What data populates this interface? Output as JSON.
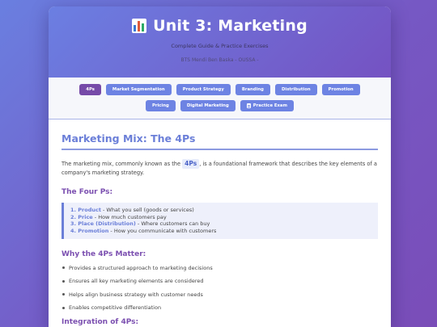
{
  "header": {
    "icon": "bar-chart-icon",
    "title": "Unit 3: Marketing",
    "subtitle": "Complete Guide & Practice Exercises",
    "source": "BTS Mendi Ben Baska - OUSSA -"
  },
  "nav": {
    "tabs": [
      {
        "label": "4Ps",
        "active": true
      },
      {
        "label": "Market Segmentation"
      },
      {
        "label": "Product Strategy"
      },
      {
        "label": "Branding"
      },
      {
        "label": "Distribution"
      },
      {
        "label": "Promotion"
      },
      {
        "label": "Pricing"
      },
      {
        "label": "Digital Marketing"
      },
      {
        "label": "Practice Exam",
        "icon": "document-icon"
      }
    ]
  },
  "section": {
    "title": "Marketing Mix: The 4Ps",
    "intro_before": "The marketing mix, commonly known as the ",
    "intro_tag": "4Ps",
    "intro_after": ", is a foundational framework that describes the key elements of a company's marketing strategy.",
    "four_ps_heading": "The Four Ps:",
    "four_ps": [
      {
        "term": "1. Product",
        "desc": " - What you sell (goods or services)"
      },
      {
        "term": "2. Price",
        "desc": " - How much customers pay"
      },
      {
        "term": "3. Place (Distribution)",
        "desc": " - Where customers can buy"
      },
      {
        "term": "4. Promotion",
        "desc": " - How you communicate with customers"
      }
    ],
    "why_heading": "Why the 4Ps Matter:",
    "why_items": [
      "Provides a structured approach to marketing decisions",
      "Ensures all key marketing elements are considered",
      "Helps align business strategy with customer needs",
      "Enables competitive differentiation"
    ],
    "integration_heading": "Integration of 4Ps:"
  },
  "colors": {
    "accent": "#6b7fd8",
    "active_tab": "#764aa8",
    "heading_purple": "#7b4fb0"
  }
}
